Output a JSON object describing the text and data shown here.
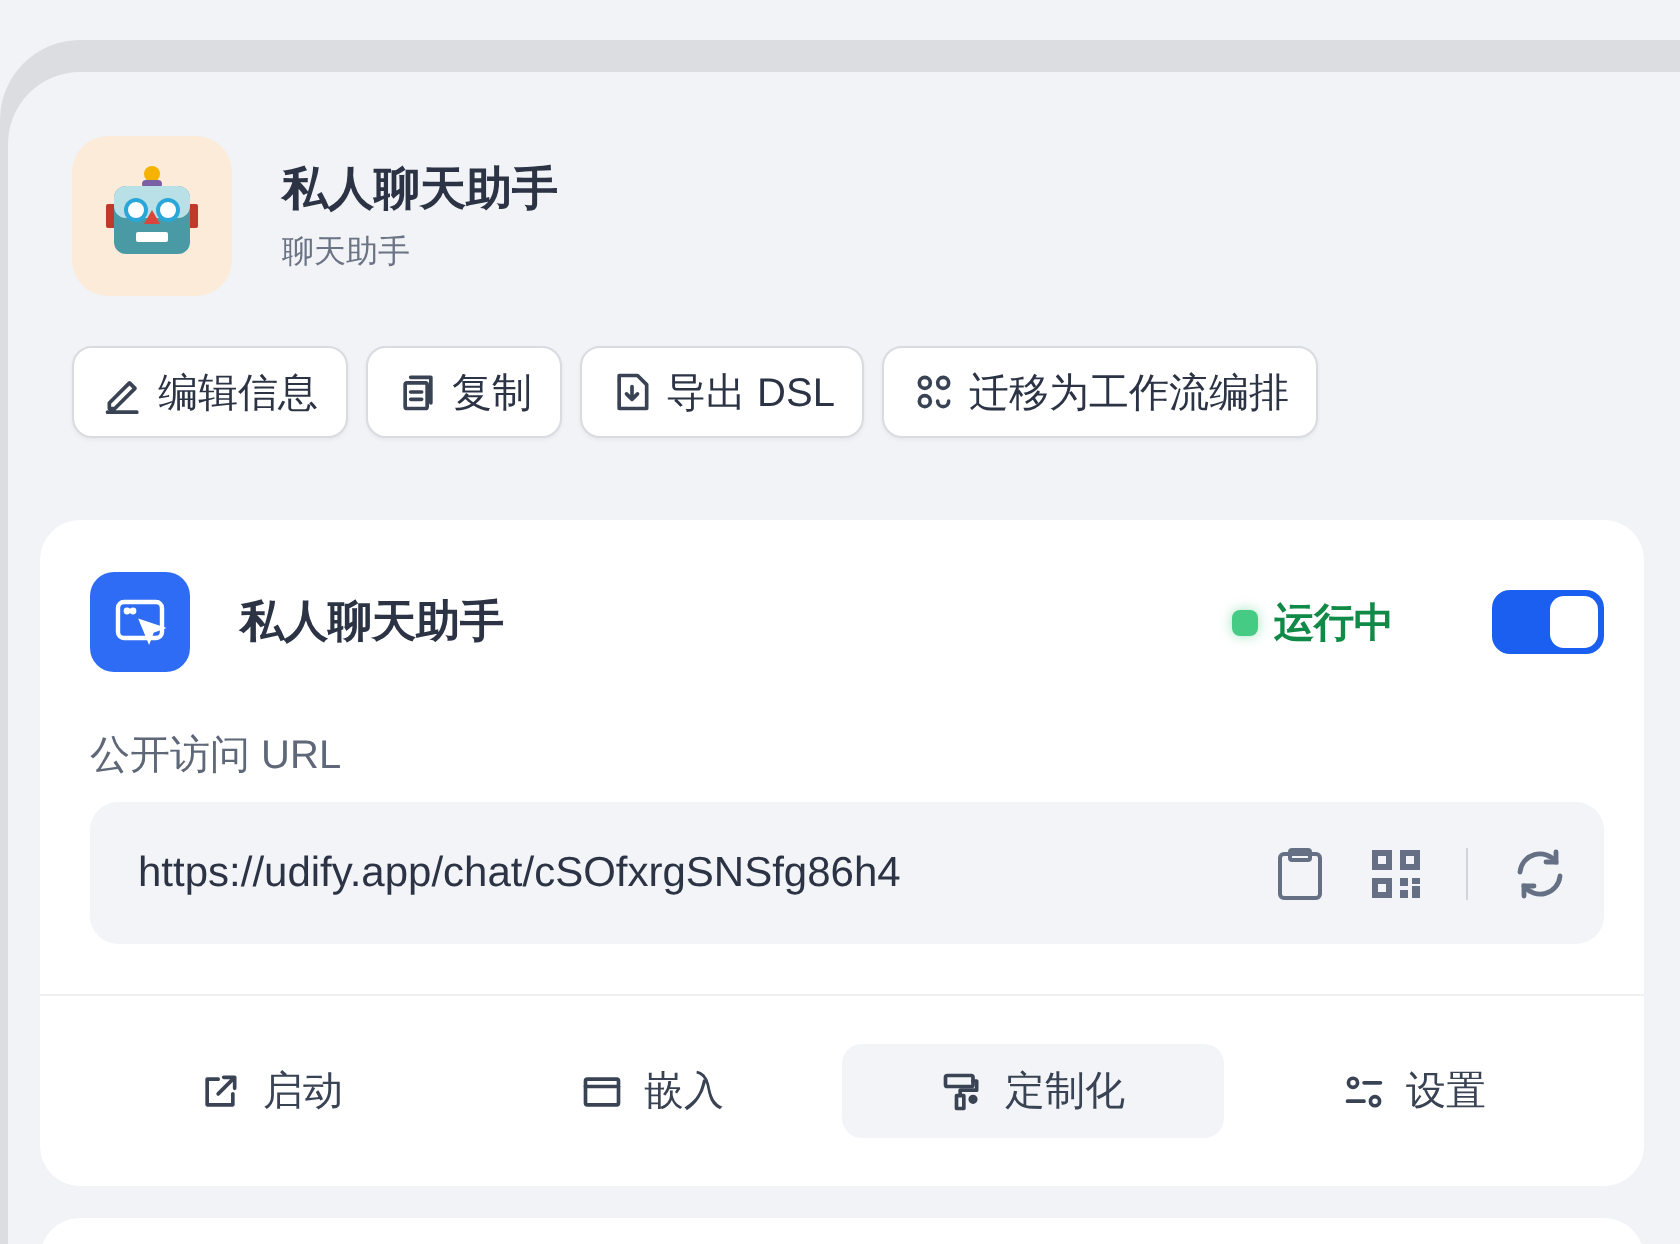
{
  "app": {
    "title": "私人聊天助手",
    "subtitle": "聊天助手"
  },
  "actions": [
    {
      "kind": "edit",
      "label": "编辑信息"
    },
    {
      "kind": "copy",
      "label": "复制"
    },
    {
      "kind": "export",
      "label": "导出 DSL"
    },
    {
      "kind": "migrate",
      "label": "迁移为工作流编排"
    }
  ],
  "webapp_card": {
    "title": "私人聊天助手",
    "status": "运行中",
    "on": true,
    "url_label": "公开访问 URL",
    "url": "https://udify.app/chat/cSOfxrgSNSfg86h4",
    "tabs": [
      {
        "kind": "launch",
        "label": "启动",
        "selected": false
      },
      {
        "kind": "embed",
        "label": "嵌入",
        "selected": false
      },
      {
        "kind": "customize",
        "label": "定制化",
        "selected": true
      },
      {
        "kind": "settings",
        "label": "设置",
        "selected": false
      }
    ]
  }
}
